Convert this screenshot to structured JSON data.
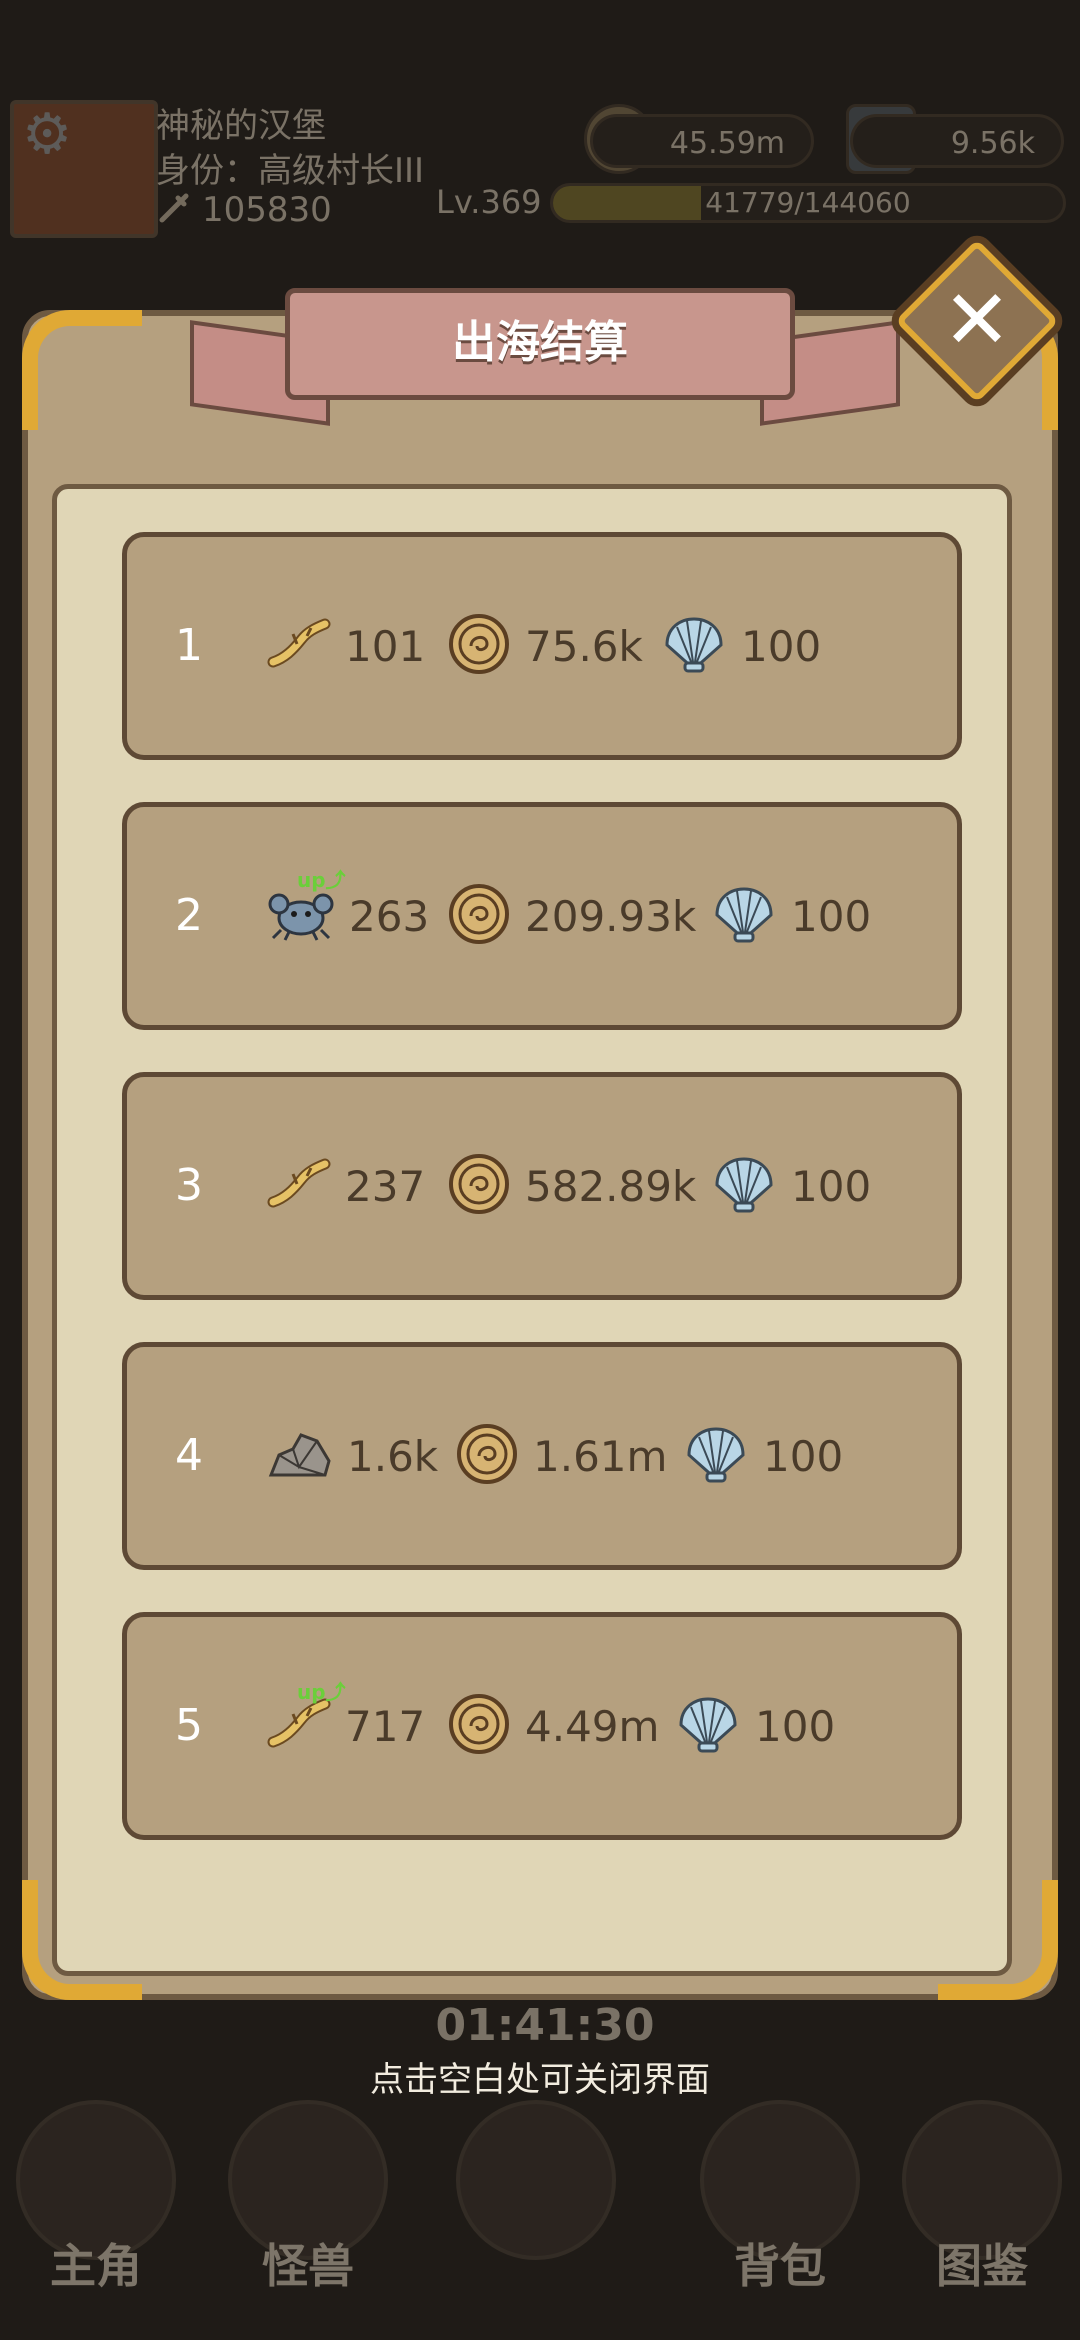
{
  "hud": {
    "player_name": "神秘的汉堡",
    "rank": "身份：高级村长III",
    "power": "105830",
    "gold": "45.59m",
    "gems": "9.56k",
    "level": "Lv.369",
    "xp_text": "41779/144060",
    "xp_progress": 0.29
  },
  "dialog": {
    "title": "出海结算",
    "close_icon": "close-icon",
    "rows": [
      {
        "num": "1",
        "item_icon": "root-icon",
        "item_value": "101",
        "up": false,
        "coin_value": "75.6k",
        "shell_value": "100"
      },
      {
        "num": "2",
        "item_icon": "crab-icon",
        "item_value": "263",
        "up": true,
        "coin_value": "209.93k",
        "shell_value": "100"
      },
      {
        "num": "3",
        "item_icon": "root-icon",
        "item_value": "237",
        "up": false,
        "coin_value": "582.89k",
        "shell_value": "100"
      },
      {
        "num": "4",
        "item_icon": "ore-icon",
        "item_value": "1.6k",
        "up": false,
        "coin_value": "1.61m",
        "shell_value": "100"
      },
      {
        "num": "5",
        "item_icon": "root-icon",
        "item_value": "717",
        "up": true,
        "coin_value": "4.49m",
        "shell_value": "100"
      }
    ],
    "up_label": "up⤴",
    "hint": "点击空白处可关闭界面"
  },
  "bottom_nav": {
    "items": [
      {
        "label": "主角"
      },
      {
        "label": "怪兽"
      },
      {
        "label": ""
      },
      {
        "label": "背包"
      },
      {
        "label": "图鉴"
      }
    ],
    "timer": "01:41:30"
  },
  "colors": {
    "panel": "#b5a07f",
    "inner": "#e0d6b6",
    "border": "#5e4935",
    "gold_trim": "#e0a935",
    "ribbon": "#c8968d"
  }
}
